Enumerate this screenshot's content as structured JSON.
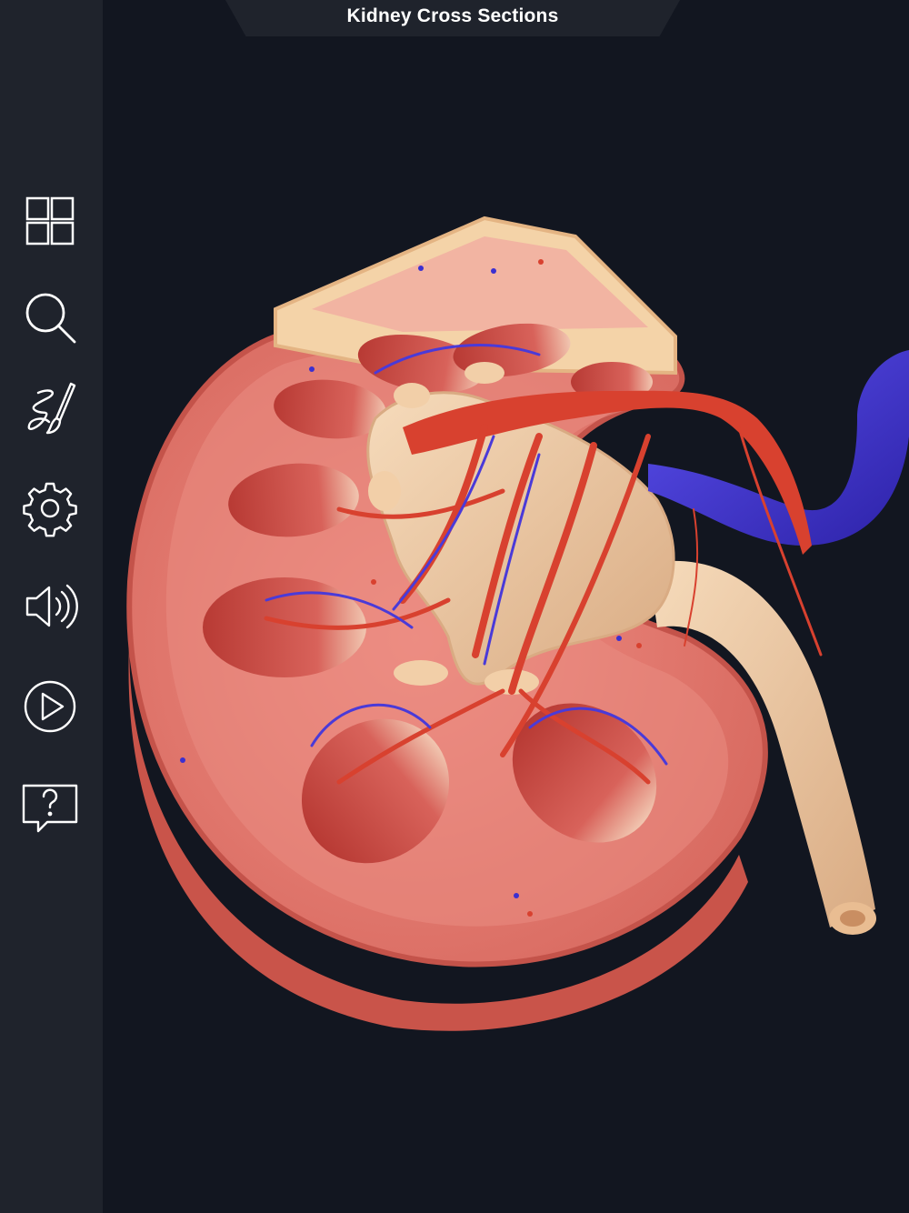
{
  "header": {
    "title": "Kidney Cross Sections"
  },
  "toolbar": {
    "items": [
      {
        "icon": "grid-icon",
        "purpose": "menu"
      },
      {
        "icon": "search-icon",
        "purpose": "search"
      },
      {
        "icon": "draw-icon",
        "purpose": "draw"
      },
      {
        "icon": "gear-icon",
        "purpose": "settings"
      },
      {
        "icon": "speaker-icon",
        "purpose": "audio"
      },
      {
        "icon": "play-icon",
        "purpose": "play"
      },
      {
        "icon": "help-icon",
        "purpose": "help"
      }
    ]
  },
  "colors": {
    "background": "#121620",
    "sidebar": "#1f232c",
    "icon": "#ffffff",
    "cortex": "#e8837a",
    "capsule": "#c9544a",
    "pyramid": "#c0453d",
    "artery": "#d8412f",
    "vein": "#3b2fd0",
    "pelvis": "#f2cfa8"
  }
}
